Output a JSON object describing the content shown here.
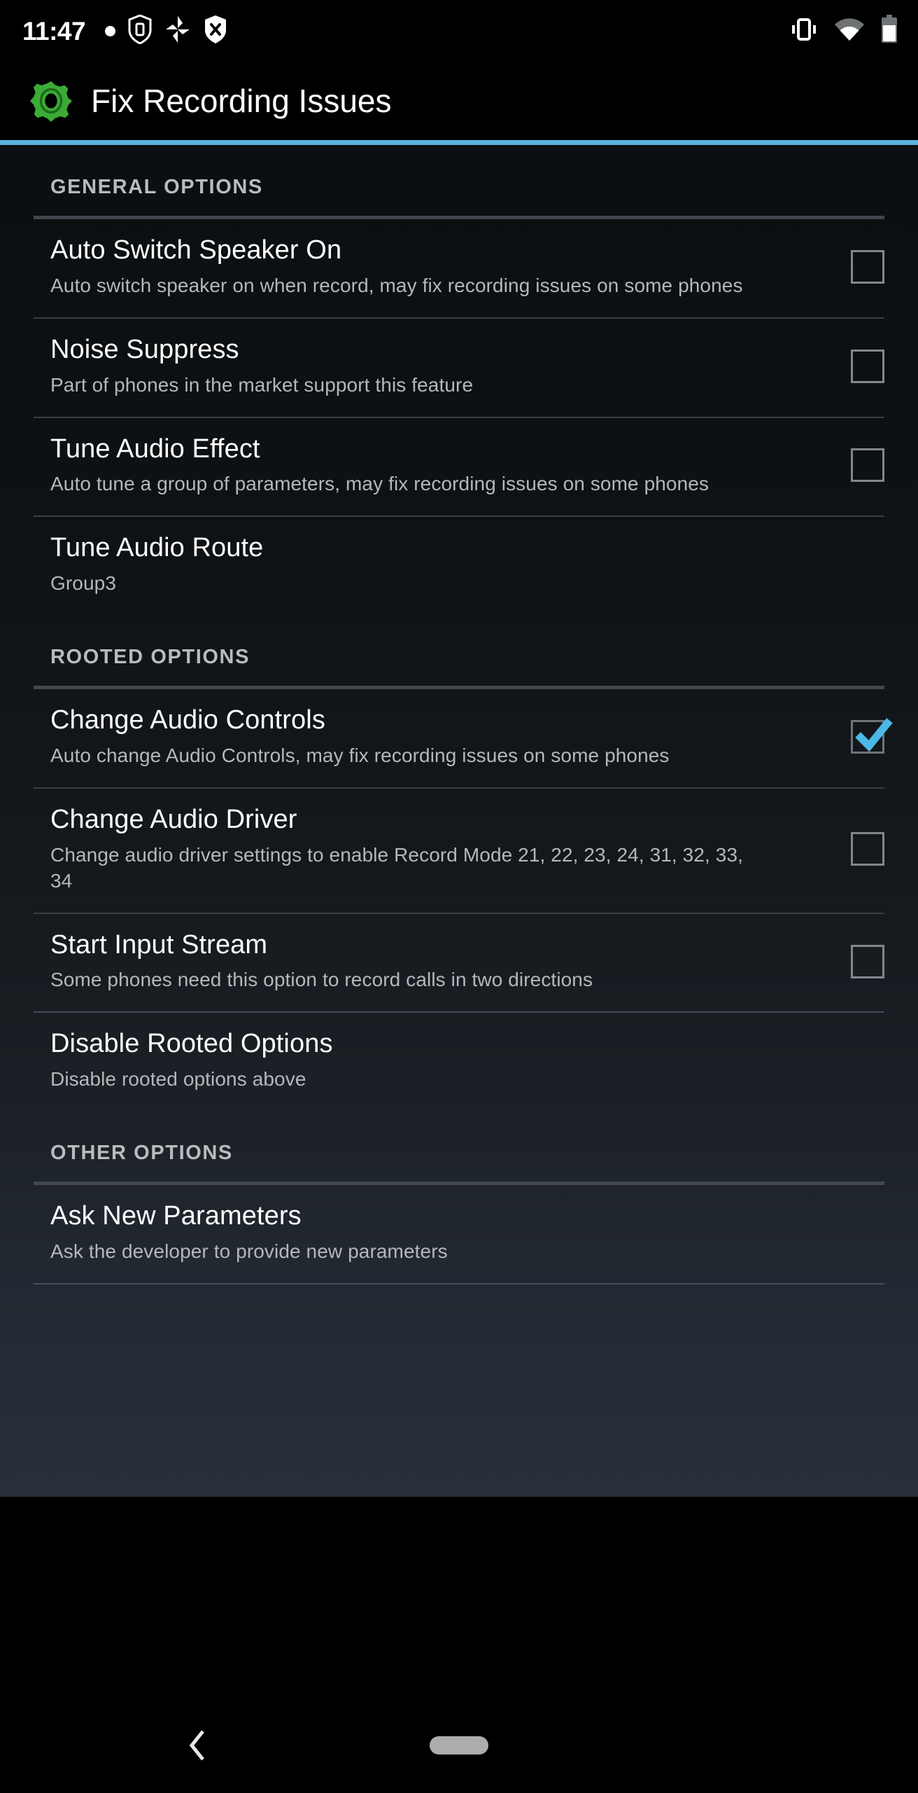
{
  "status_bar": {
    "time": "11:47",
    "left_icons": [
      "dot-indicator",
      "shield-icon",
      "pinwheel-icon",
      "shield-x-icon"
    ],
    "right_icons": [
      "vibrate-icon",
      "wifi-icon",
      "battery-icon"
    ],
    "battery_level_percent": 75
  },
  "app_bar": {
    "icon": "gear-icon",
    "icon_color": "#3bab36",
    "title": "Fix Recording Issues",
    "accent_color": "#5ab3e0"
  },
  "sections": [
    {
      "id": "general",
      "header": "GENERAL OPTIONS",
      "items": [
        {
          "title": "Auto Switch Speaker On",
          "subtitle": "Auto switch speaker on when record, may fix recording issues on some phones",
          "control": "checkbox",
          "checked": false
        },
        {
          "title": "Noise Suppress",
          "subtitle": "Part of phones in the market support this feature",
          "control": "checkbox",
          "checked": false
        },
        {
          "title": "Tune Audio Effect",
          "subtitle": "Auto tune a group of parameters, may fix recording issues on some phones",
          "control": "checkbox",
          "checked": false
        },
        {
          "title": "Tune Audio Route",
          "subtitle": "Group3",
          "control": "none",
          "checked": false
        }
      ]
    },
    {
      "id": "rooted",
      "header": "ROOTED OPTIONS",
      "items": [
        {
          "title": "Change Audio Controls",
          "subtitle": "Auto change Audio Controls, may fix recording issues on some phones",
          "control": "checkbox",
          "checked": true
        },
        {
          "title": "Change Audio Driver",
          "subtitle": "Change audio driver settings to enable Record Mode 21, 22, 23, 24, 31, 32, 33, 34",
          "control": "checkbox",
          "checked": false
        },
        {
          "title": "Start Input Stream",
          "subtitle": "Some phones need this option to record calls in two directions",
          "control": "checkbox",
          "checked": false
        },
        {
          "title": "Disable Rooted Options",
          "subtitle": "Disable rooted options above",
          "control": "none",
          "checked": false
        }
      ]
    },
    {
      "id": "other",
      "header": "OTHER OPTIONS",
      "items": [
        {
          "title": "Ask New Parameters",
          "subtitle": "Ask the developer to provide new parameters",
          "control": "none",
          "checked": false
        }
      ]
    }
  ],
  "nav_bar": {
    "back_icon": "back-chevron-icon",
    "home_icon": "home-pill-icon"
  },
  "colors": {
    "accent": "#5ab3e0",
    "checkbox_check": "#4cb8e8",
    "gear_green": "#3bab36",
    "title_text": "#ffffff",
    "subtitle_text": "#b4b8bb",
    "section_text": "#b9bcbe"
  }
}
